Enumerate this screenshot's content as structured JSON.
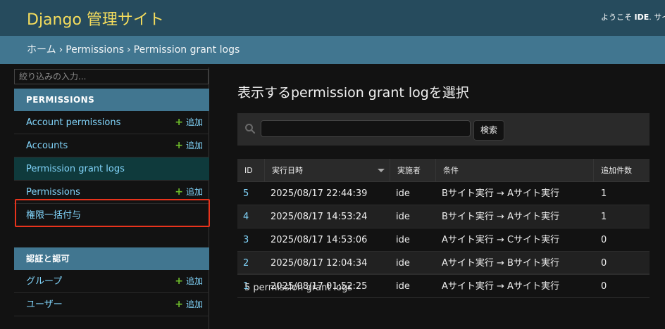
{
  "header": {
    "site_name": "Django 管理サイト",
    "welcome": "ようこそ ",
    "username": "IDE",
    "view_site": ". サイ"
  },
  "breadcrumbs": {
    "home": "ホーム",
    "separator": "›",
    "app": "Permissions",
    "current": "Permission grant logs"
  },
  "sidebar": {
    "filter_placeholder": "絞り込みの入力...",
    "modules": [
      {
        "caption": "PERMISSIONS",
        "items": [
          {
            "label": "Account permissions",
            "add": "追加"
          },
          {
            "label": "Accounts",
            "add": "追加"
          },
          {
            "label": "Permission grant logs",
            "add": ""
          },
          {
            "label": "Permissions",
            "add": "追加"
          },
          {
            "label": "権限一括付与",
            "add": ""
          }
        ]
      },
      {
        "caption": "認証と認可",
        "items": [
          {
            "label": "グループ",
            "add": "追加"
          },
          {
            "label": "ユーザー",
            "add": "追加"
          }
        ]
      }
    ],
    "add_icon": "plus-icon"
  },
  "main": {
    "title": "表示するpermission grant logを選択",
    "search_value": "",
    "search_button": "検索",
    "search_icon": "search-icon",
    "table": {
      "columns": [
        "ID",
        "実行日時",
        "実施者",
        "条件",
        "追加件数"
      ],
      "rows": [
        [
          "5",
          "2025/08/17 22:44:39",
          "ide",
          "Bサイト実行 → Aサイト実行",
          "1"
        ],
        [
          "4",
          "2025/08/17 14:53:24",
          "ide",
          "Bサイト実行 → Aサイト実行",
          "1"
        ],
        [
          "3",
          "2025/08/17 14:53:06",
          "ide",
          "Aサイト実行 → Cサイト実行",
          "0"
        ],
        [
          "2",
          "2025/08/17 12:04:34",
          "ide",
          "Aサイト実行 → Bサイト実行",
          "0"
        ],
        [
          "1",
          "2025/08/17 01:52:25",
          "ide",
          "Aサイト実行 → Aサイト実行",
          "0"
        ]
      ]
    },
    "result_count": "5 permission grant logs"
  },
  "colors": {
    "header_bg": "#264b5d",
    "breadcrumb_bg": "#417690",
    "brand": "#f5dd5d",
    "link": "#81d4fa",
    "add_plus": "#70bf2b",
    "highlight": "#e8331c"
  }
}
